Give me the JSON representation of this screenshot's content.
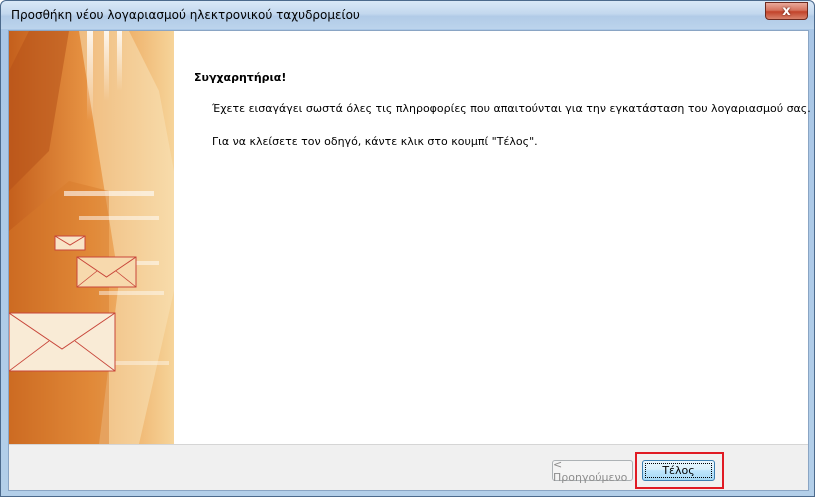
{
  "window": {
    "title": "Προσθήκη νέου λογαριασμού ηλεκτρονικού ταχυδρομείου",
    "close_glyph": "x"
  },
  "content": {
    "heading": "Συγχαρητήρια!",
    "paragraph_1": "Έχετε εισαγάγει σωστά όλες τις πληροφορίες που απαιτούνται για την εγκατάσταση του λογαριασμού σας.",
    "paragraph_2": "Για να κλείσετε τον οδηγό, κάντε κλικ στο κουμπί \"Τέλος\"."
  },
  "footer": {
    "back_label": "< Προηγούμενο",
    "finish_label": "Τέλος"
  },
  "colors": {
    "highlight": "#e01b24",
    "banner_orange": "#e8a050",
    "envelope_line": "#c8463a"
  },
  "icons": {
    "banner": "envelope-icon"
  }
}
